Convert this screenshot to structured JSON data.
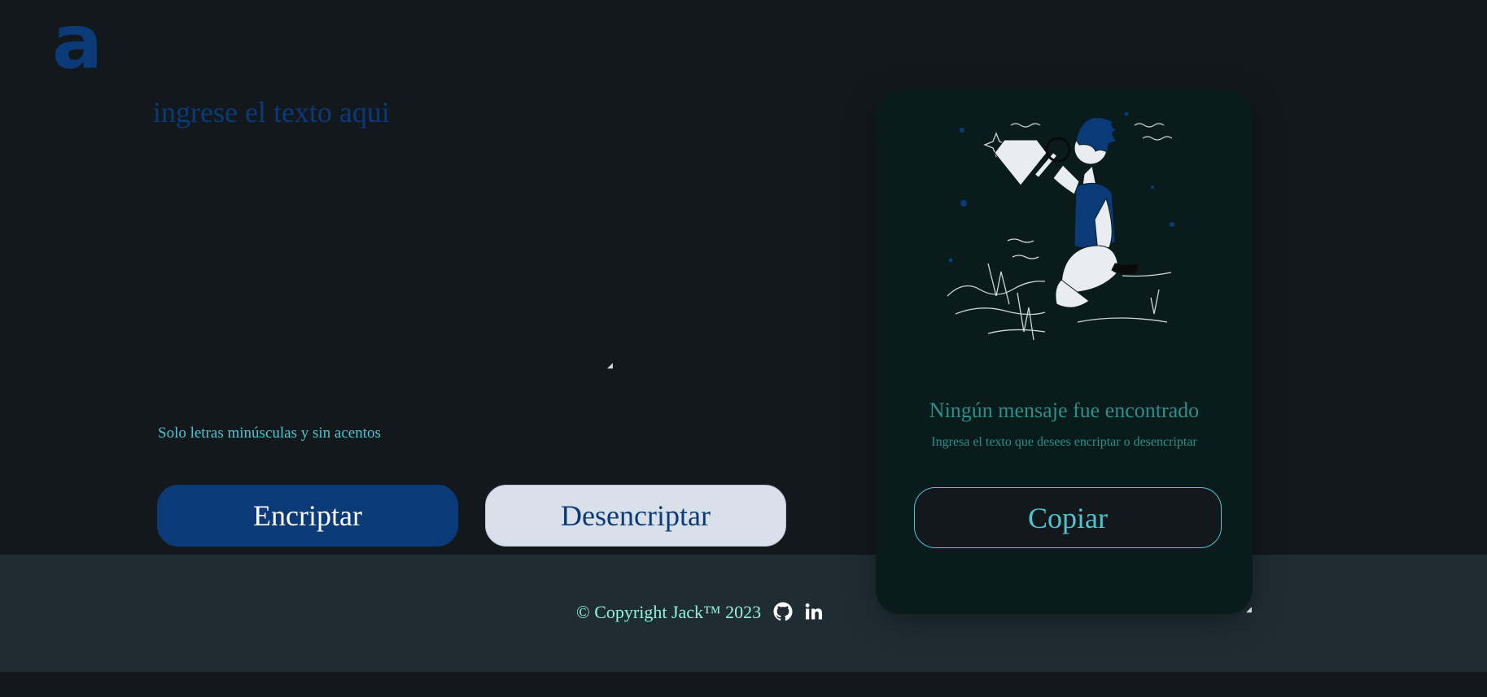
{
  "logo": {
    "glyph": "a"
  },
  "input": {
    "placeholder": "ingrese el texto aqui",
    "value": ""
  },
  "hint": "Solo letras minúsculas y sin acentos",
  "buttons": {
    "encrypt": "Encriptar",
    "decrypt": "Desencriptar"
  },
  "output": {
    "title": "Ningún mensaje fue encontrado",
    "subtitle": "Ingresa el texto que desees encriptar o desencriptar",
    "copy": "Copiar"
  },
  "footer": {
    "copyright": "© Copyright Jack™ 2023",
    "icons": [
      "github-icon",
      "linkedin-icon"
    ]
  },
  "colors": {
    "background": "#13181d",
    "primary": "#0b3a78",
    "accent": "#4ec6cf",
    "panel": "#0a1b1c",
    "footer": "#1f2d33",
    "copyright": "#8ff5d8"
  }
}
